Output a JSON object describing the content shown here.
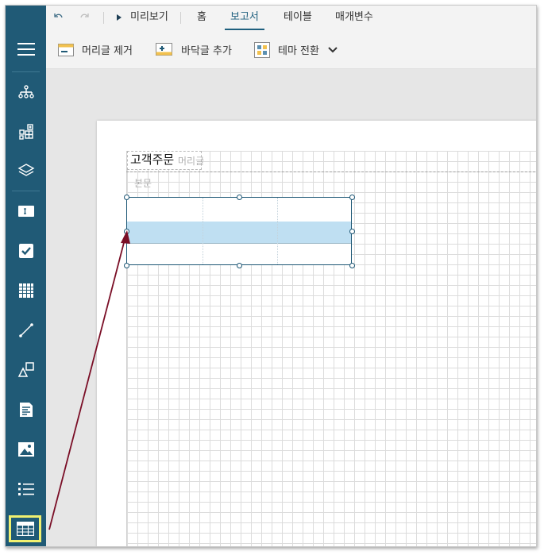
{
  "toolbar": {
    "undo_icon": "undo-icon",
    "redo_icon": "redo-icon",
    "preview_label": "미리보기",
    "tabs": [
      {
        "label": "홈",
        "active": false
      },
      {
        "label": "보고서",
        "active": true
      },
      {
        "label": "테이블",
        "active": false
      },
      {
        "label": "매개변수",
        "active": false
      }
    ]
  },
  "ribbon": {
    "remove_header_label": "머리글 제거",
    "add_footer_label": "바닥글 추가",
    "switch_theme_label": "테마 전환"
  },
  "sidebar": {
    "items": [
      {
        "icon": "hamburger-menu-icon"
      },
      {
        "icon": "hierarchy-icon"
      },
      {
        "icon": "component-icon"
      },
      {
        "icon": "layers-icon"
      },
      {
        "icon": "textbox-icon"
      },
      {
        "icon": "checkbox-icon"
      },
      {
        "icon": "grid-dots-icon"
      },
      {
        "icon": "line-icon"
      },
      {
        "icon": "shapes-icon"
      },
      {
        "icon": "richtext-icon"
      },
      {
        "icon": "image-icon"
      },
      {
        "icon": "list-icon"
      },
      {
        "icon": "table-icon",
        "selected": true
      }
    ]
  },
  "report": {
    "title_text": "고객주문",
    "header_ghost": "머리글",
    "body_ghost": "본문"
  },
  "colors": {
    "sidebar_bg": "#205a76",
    "accent": "#1e5f7e",
    "selection_highlight": "#f0f070",
    "table_selected_row": "#bfdff2",
    "arrow": "#7a0e26"
  }
}
